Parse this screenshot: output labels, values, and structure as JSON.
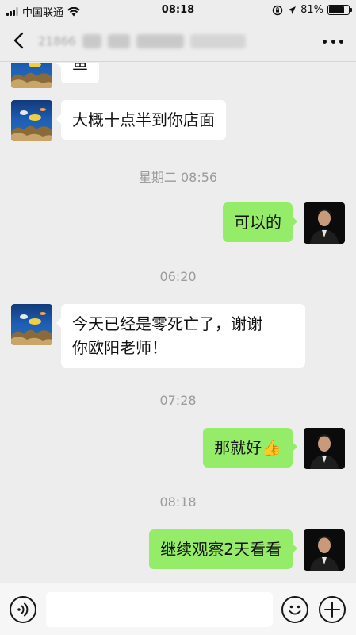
{
  "status_bar": {
    "carrier": "中国联通",
    "time": "08:18",
    "battery_percent": "81%",
    "battery_level": 0.81
  },
  "nav": {
    "title_visible_fragment": "21866"
  },
  "messages": [
    {
      "side": "left",
      "text": "鱼"
    },
    {
      "side": "left",
      "text": "大概十点半到你店面"
    },
    {
      "timestamp": "星期二 08:56"
    },
    {
      "side": "right",
      "text": "可以的"
    },
    {
      "timestamp": "06:20"
    },
    {
      "side": "left",
      "text_line1": "今天已经是零死亡了，谢谢",
      "text_line2": "你欧阳老师！"
    },
    {
      "timestamp": "07:28"
    },
    {
      "side": "right",
      "text": "那就好",
      "emoji": "👍"
    },
    {
      "timestamp": "08:18"
    },
    {
      "side": "right",
      "text": "继续观察2天看看"
    }
  ],
  "colors": {
    "background": "#ededed",
    "sent_bubble": "#95ec69",
    "received_bubble": "#ffffff",
    "timestamp_text": "#9b9b9b"
  },
  "input_bar": {
    "voice_icon": "voice-icon",
    "emoji_icon": "emoji-icon",
    "plus_icon": "plus-icon"
  }
}
